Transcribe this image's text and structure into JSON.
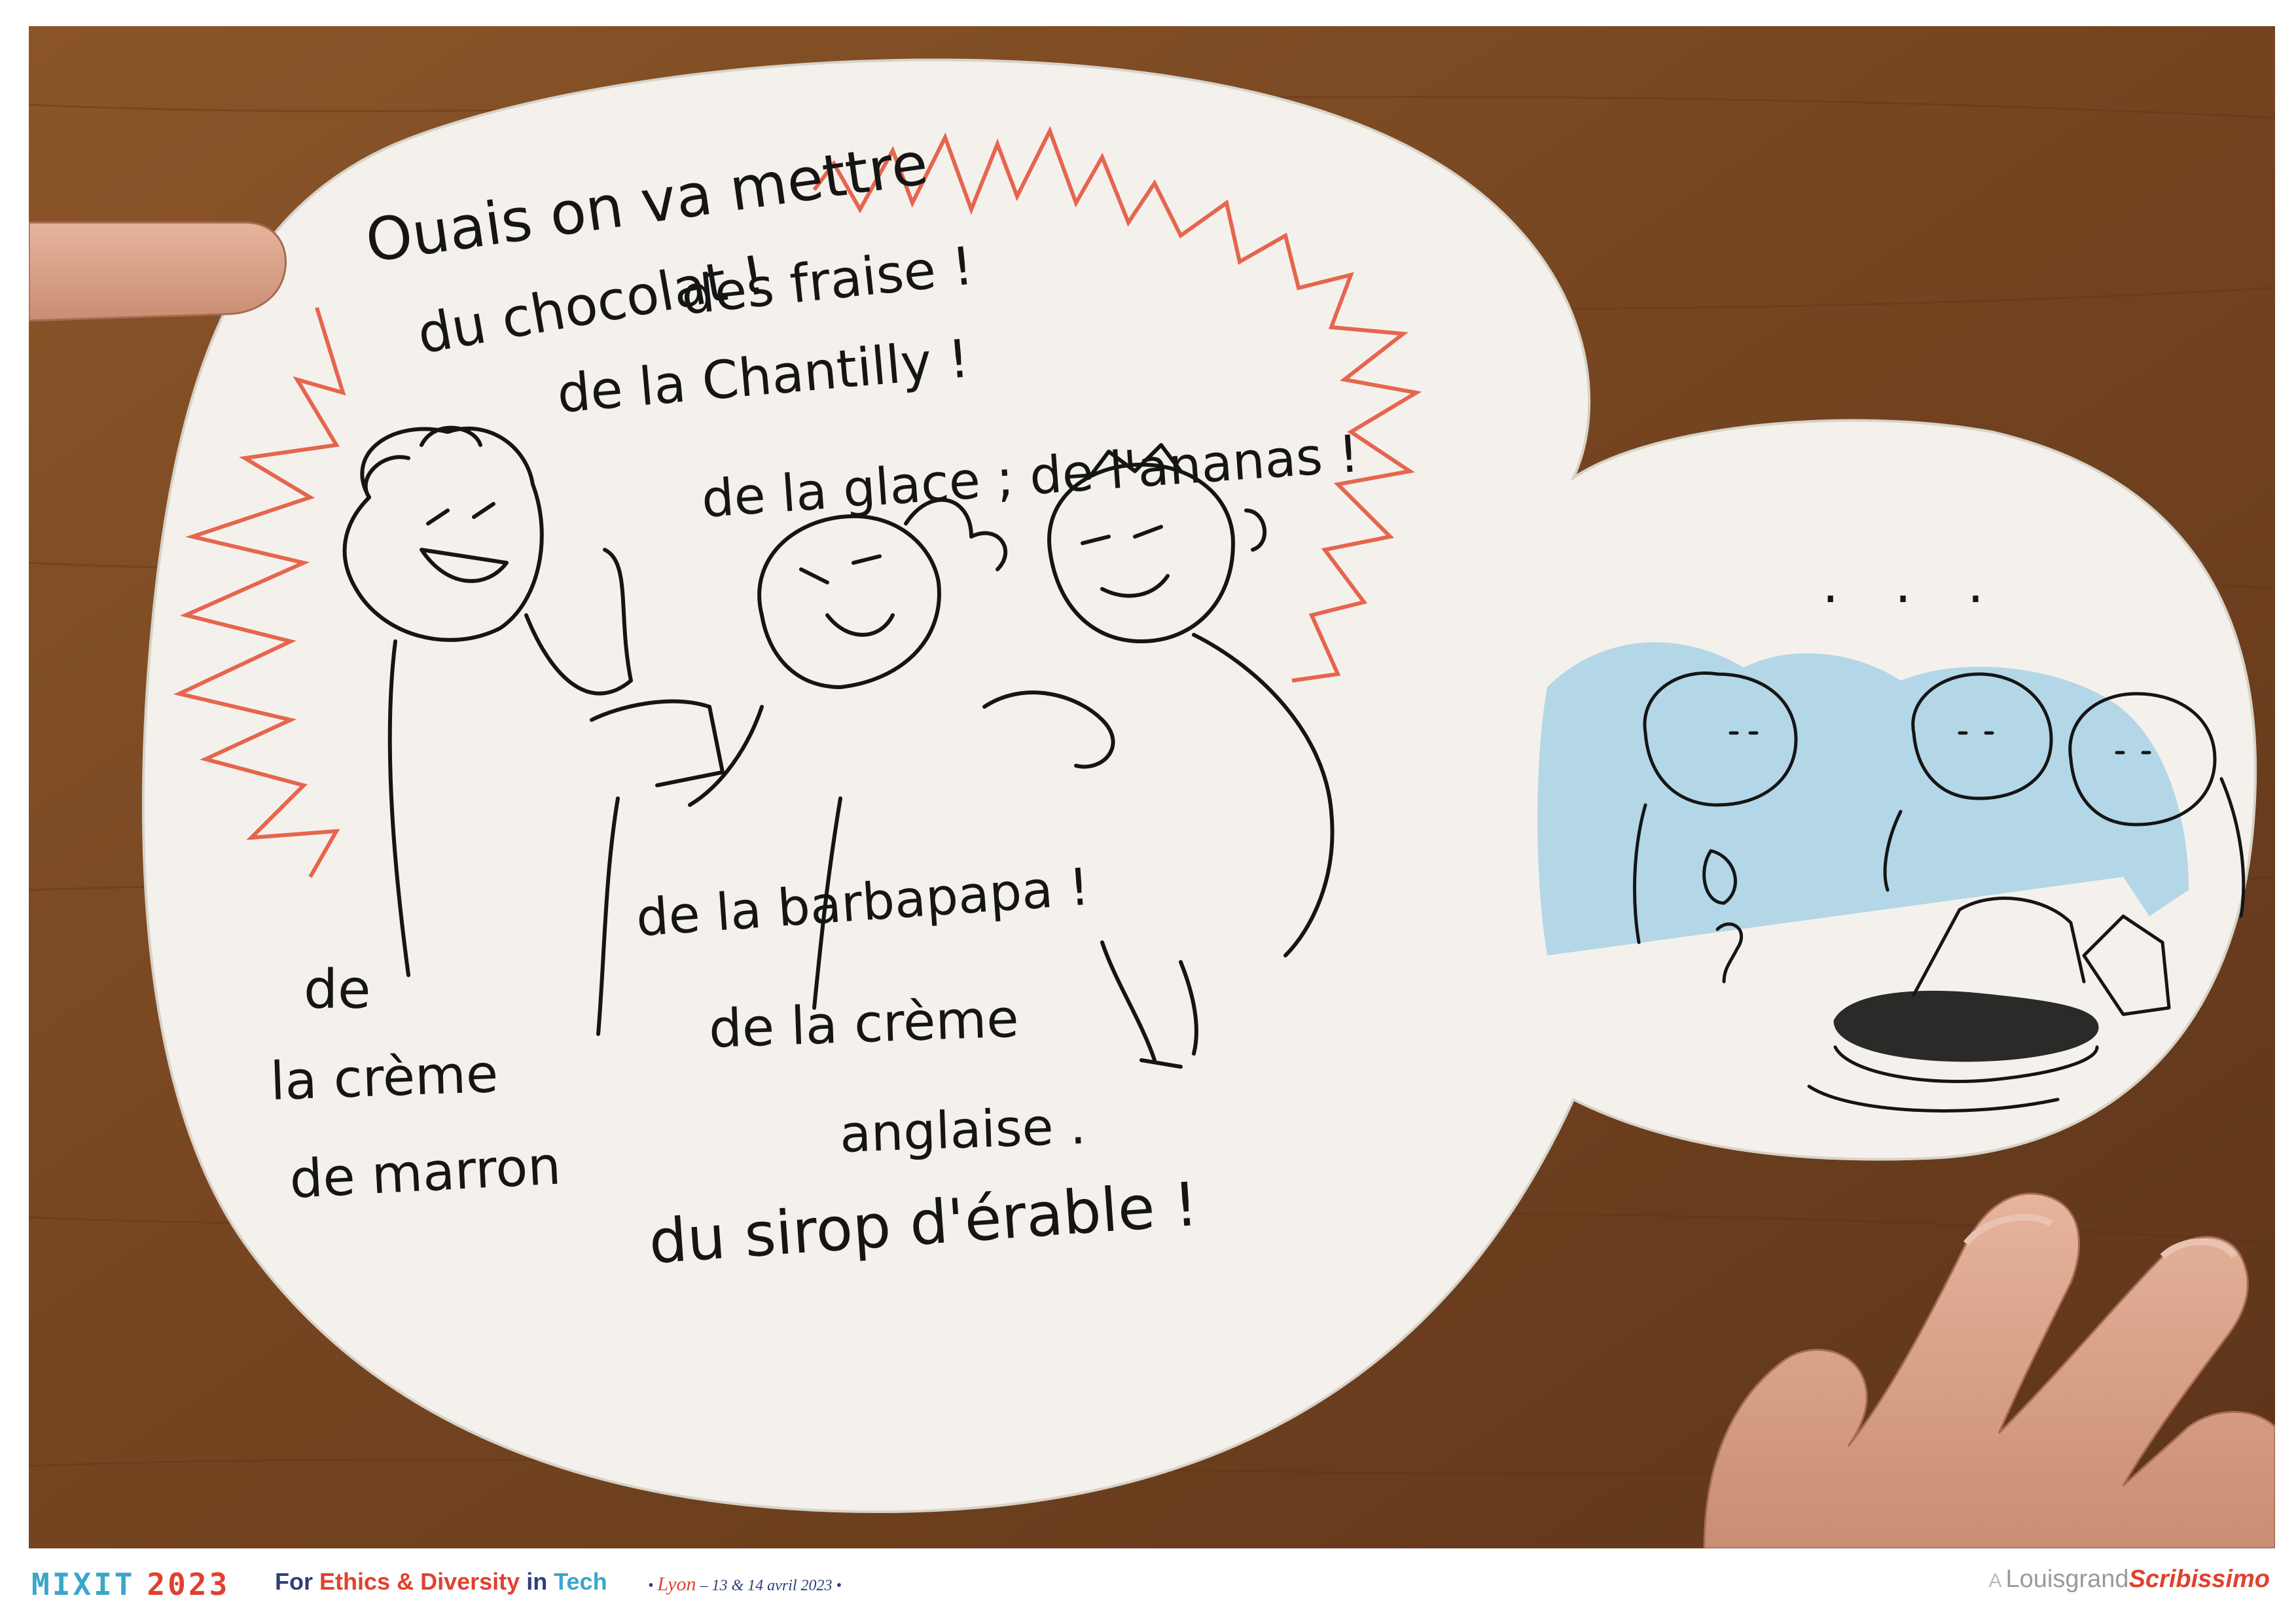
{
  "comic": {
    "speech_lines": [
      "Ouais on va mettre",
      "du chocolat !",
      "des fraise !",
      "de la Chantilly !",
      "de la glace ; de l'ananas !",
      "de la barbapapa !",
      "de la crème",
      "anglaise .",
      "de",
      "la crème",
      "de marron",
      "du sirop d'érable !"
    ],
    "second_panel_dots": ". . ."
  },
  "footer": {
    "logo": "MIXIT",
    "year": "2023",
    "tagline_for": "For",
    "tagline_ethics": "Ethics",
    "tagline_amp": "&",
    "tagline_diversity": "Diversity",
    "tagline_in": "in",
    "tagline_tech": "Tech",
    "event_city": "Lyon",
    "event_dates": "13 & 14 avril 2023",
    "credit_prefix": "A",
    "credit_author": "Louisgrand",
    "credit_brand": "Scribissimo"
  },
  "colors": {
    "wood": "#7a4a22",
    "paper": "#f4f1ec",
    "burst": "#e4553d",
    "watercolor": "#9ecde6",
    "ink": "#151515",
    "footer_red": "#e0412f",
    "footer_blue": "#3aa7c9",
    "footer_navy": "#2e3f7a"
  }
}
